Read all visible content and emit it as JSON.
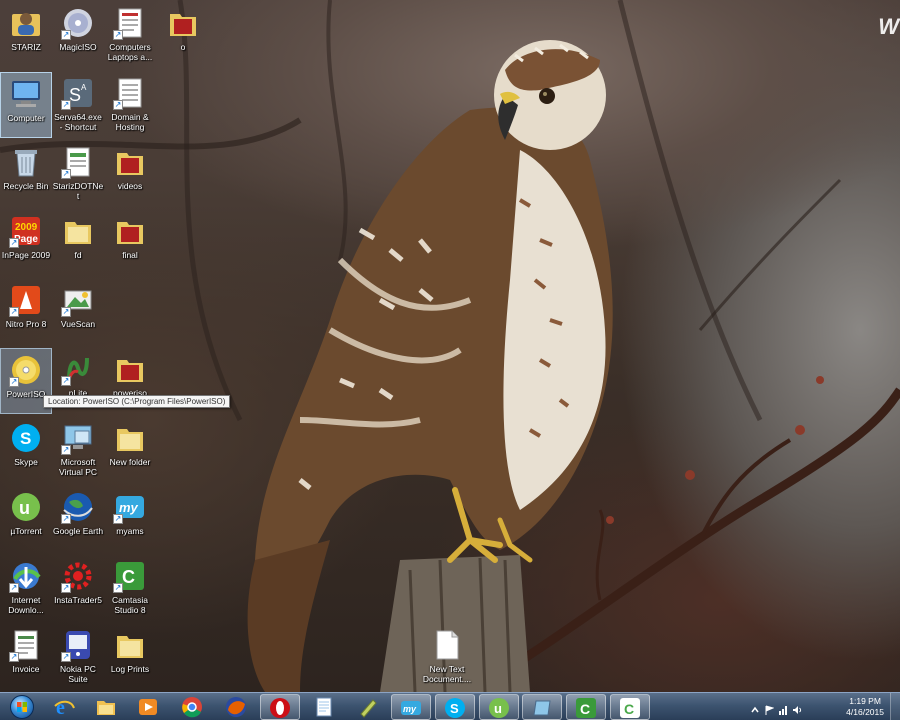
{
  "desktop": {
    "corner_text": "W",
    "tooltip": "Location: PowerISO (C:\\Program Files\\PowerISO)",
    "icons": [
      {
        "label": "STARIZ",
        "icon": "user-folder-icon"
      },
      {
        "label": "MagicISO",
        "icon": "disc-icon"
      },
      {
        "label": "Computers Laptops a...",
        "icon": "document-icon"
      },
      {
        "label": "o",
        "icon": "folder-red-icon"
      },
      {
        "label": "Computer",
        "icon": "computer-icon"
      },
      {
        "label": "Serva64.exe - Shortcut",
        "icon": "serva-icon"
      },
      {
        "label": "Domain & Hosting",
        "icon": "document-icon"
      },
      {
        "label": "Recycle Bin",
        "icon": "recycle-bin-icon"
      },
      {
        "label": "StarizDOTNet",
        "icon": "document-icon"
      },
      {
        "label": "videos",
        "icon": "folder-red-icon"
      },
      {
        "label": "InPage 2009",
        "icon": "inpage-icon"
      },
      {
        "label": "fd",
        "icon": "folder-icon"
      },
      {
        "label": "final",
        "icon": "folder-red-icon"
      },
      {
        "label": "Nitro Pro 8",
        "icon": "nitro-icon"
      },
      {
        "label": "VueScan",
        "icon": "vuescan-icon"
      },
      {
        "label": "PowerISO",
        "icon": "poweriso-icon"
      },
      {
        "label": "nLite",
        "icon": "nlite-icon"
      },
      {
        "label": "poweriso",
        "icon": "folder-red-icon"
      },
      {
        "label": "Skype",
        "icon": "skype-icon"
      },
      {
        "label": "Microsoft Virtual PC",
        "icon": "virtual-pc-icon"
      },
      {
        "label": "New folder",
        "icon": "folder-icon"
      },
      {
        "label": "µTorrent",
        "icon": "utorrent-icon"
      },
      {
        "label": "Google Earth",
        "icon": "google-earth-icon"
      },
      {
        "label": "myams",
        "icon": "myams-icon"
      },
      {
        "label": "Internet Downlo...",
        "icon": "idm-icon"
      },
      {
        "label": "InstaTrader5",
        "icon": "instatrader-icon"
      },
      {
        "label": "Camtasia Studio 8",
        "icon": "camtasia-icon"
      },
      {
        "label": "Invoice",
        "icon": "document-icon"
      },
      {
        "label": "Nokia PC Suite",
        "icon": "nokia-icon"
      },
      {
        "label": "Log Prints",
        "icon": "folder-icon"
      },
      {
        "label": "New Text Document....",
        "icon": "text-file-icon"
      }
    ]
  },
  "taskbar": {
    "pinned": [
      {
        "name": "ie-icon",
        "color": "#1e90ff"
      },
      {
        "name": "explorer-icon",
        "color": "#f0c050"
      },
      {
        "name": "media-player-icon",
        "color": "#f08a24"
      },
      {
        "name": "chrome-icon",
        "color": "#db4437"
      },
      {
        "name": "firefox-icon",
        "color": "#e66000"
      },
      {
        "name": "opera-icon",
        "color": "#cc0f16"
      },
      {
        "name": "notepad-icon",
        "color": "#9fc4e8"
      },
      {
        "name": "pen-icon",
        "color": "#c0d060"
      },
      {
        "name": "myams-icon",
        "color": "#35a9e0"
      },
      {
        "name": "skype-icon",
        "color": "#00aff0"
      },
      {
        "name": "utorrent-icon",
        "color": "#78c04c"
      },
      {
        "name": "virtual-pc-icon",
        "color": "#8ec6e8"
      },
      {
        "name": "camtasia-icon",
        "color": "#3a9a3a"
      },
      {
        "name": "camtasia-recorder-icon",
        "color": "#4aa84a"
      }
    ],
    "clock": {
      "time": "1:19 PM",
      "date": "4/16/2015"
    }
  }
}
